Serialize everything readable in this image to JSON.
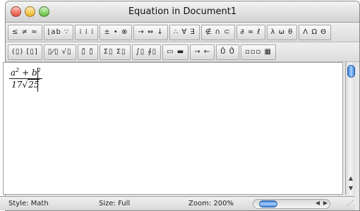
{
  "window": {
    "title": "Equation in Document1"
  },
  "toolbar": {
    "row1": [
      "≤ ≠ ≈",
      "⌊ab ∵",
      "⁞ ⁞ ⁞",
      "± • ⊗",
      "→ ⇔ ↓",
      "∴ ∀ ∃",
      "∉ ∩ ⊂",
      "∂ ∞ ℓ",
      "λ ω θ",
      "Λ Ω Θ"
    ],
    "row2": [
      "(▯) [▯]",
      "▯⁄▯ √▯",
      "▯̄ ▯̂",
      "Σ▯ Σ▯",
      "∫▯ ∮▯",
      "▭ ▬",
      "→ ←",
      "Ů Ů̇",
      "▫▫▫ ▦"
    ]
  },
  "equation": {
    "numerator": "a",
    "sup1": "2",
    "plus": "+",
    "b": "b",
    "sup2": "2",
    "denominator_coef": "17",
    "radical": "√",
    "radicand": "25"
  },
  "status": {
    "style": "Style: Math",
    "size": "Size: Full",
    "zoom": "Zoom: 200%"
  }
}
